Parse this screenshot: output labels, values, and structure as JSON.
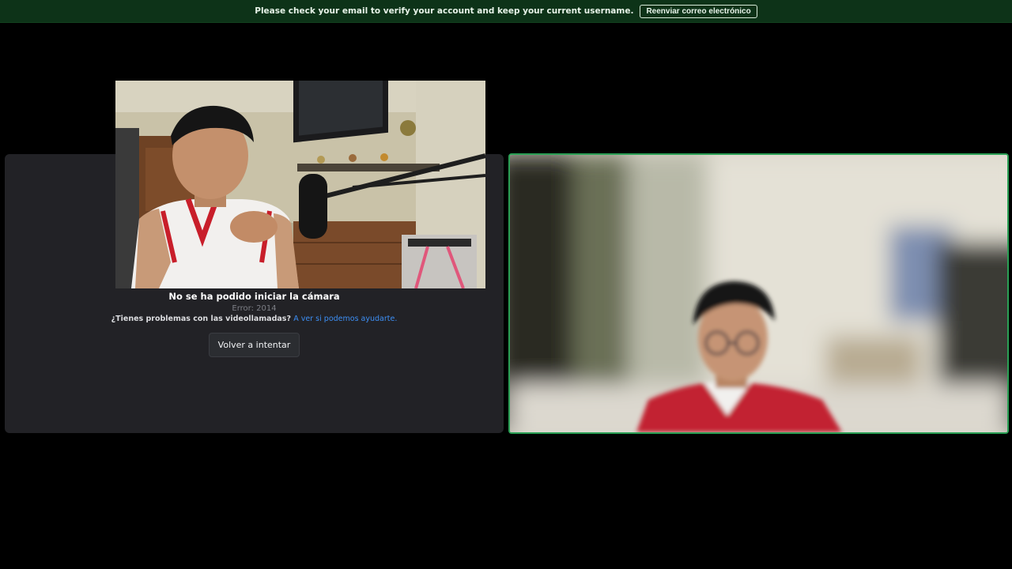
{
  "banner": {
    "message": "Please check your email to verify your account and keep your current username.",
    "button_label": "Reenviar correo electrónico"
  },
  "camera_error": {
    "title": "No se ha podido iniciar la cámara",
    "code": "Error: 2014",
    "help_question": "¿Tienes problemas con las videollamadas?",
    "help_link": "A ver si podemos ayudarte.",
    "retry_label": "Volver a intentar"
  },
  "colors": {
    "banner_bg": "#0d3318",
    "speaking_border": "#2aa055",
    "link": "#3d8ff5",
    "tile_bg": "#222226"
  }
}
